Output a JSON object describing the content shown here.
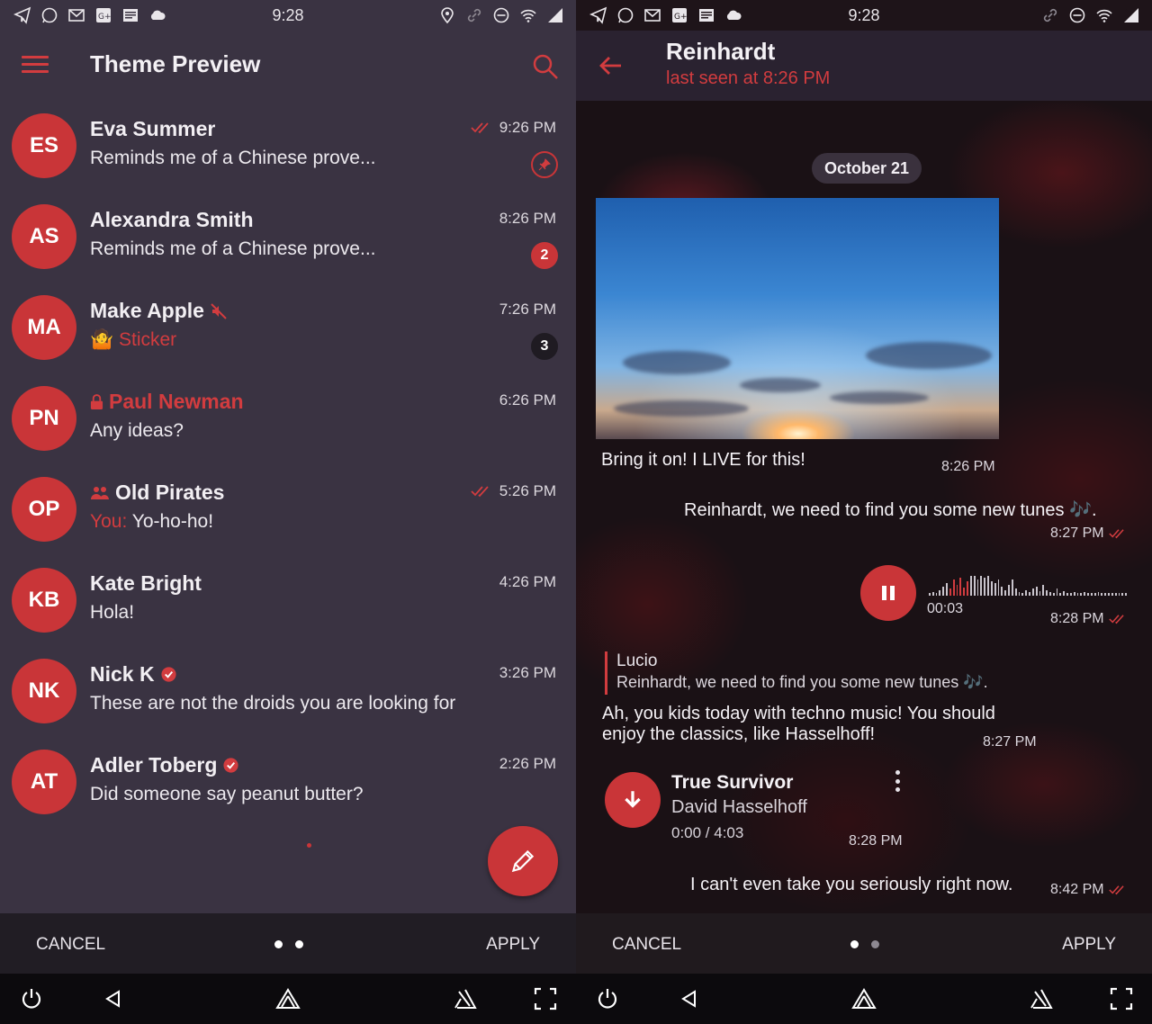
{
  "status_bar": {
    "time": "9:28"
  },
  "left": {
    "appbar": {
      "title": "Theme Preview"
    },
    "chats": [
      {
        "initials": "ES",
        "name": "Eva Summer",
        "message": "Reminds me of a Chinese prove...",
        "time": "9:26 PM",
        "read": true,
        "pinned": true
      },
      {
        "initials": "AS",
        "name": "Alexandra Smith",
        "message": "Reminds me of a Chinese prove...",
        "time": "8:26 PM",
        "badge": "2"
      },
      {
        "initials": "MA",
        "name": "Make Apple",
        "muted": true,
        "sticker_label": "Sticker",
        "time": "7:26 PM",
        "badge": "3"
      },
      {
        "initials": "PN",
        "name": "Paul Newman",
        "secret": true,
        "message": "Any ideas?",
        "time": "6:26 PM"
      },
      {
        "initials": "OP",
        "name": "Old Pirates",
        "group": true,
        "sender_prefix": "You:",
        "message": " Yo-ho-ho!",
        "time": "5:26 PM",
        "read": true
      },
      {
        "initials": "KB",
        "name": "Kate Bright",
        "message": "Hola!",
        "time": "4:26 PM"
      },
      {
        "initials": "NK",
        "name": "Nick K",
        "verified": true,
        "message": "These are not the droids you are looking for",
        "time": "3:26 PM"
      },
      {
        "initials": "AT",
        "name": "Adler Toberg",
        "verified": true,
        "message": "Did someone say peanut butter?",
        "time": "2:26 PM"
      }
    ],
    "bottom": {
      "cancel": "CANCEL",
      "apply": "APPLY"
    }
  },
  "right": {
    "header": {
      "name": "Reinhardt",
      "status": "last seen at 8:26 PM"
    },
    "date_pill": "October 21",
    "messages": {
      "photo_caption": "Bring it on! I LIVE for this!",
      "photo_time": "8:26 PM",
      "out1_text": "Reinhardt, we need to find you some new tunes 🎶.",
      "out1_time": "8:27 PM",
      "voice_duration": "00:03",
      "voice_time": "8:28 PM",
      "reply_name": "Lucio",
      "reply_text": "Reinhardt, we need to find you some new tunes 🎶.",
      "in2_line1": "Ah, you kids today with techno music! You should",
      "in2_line2": "enjoy the classics, like Hasselhoff!",
      "in2_time": "8:27 PM",
      "track_title": "True Survivor",
      "track_artist": "David Hasselhoff",
      "track_progress": "0:00 / 4:03",
      "track_time": "8:28 PM",
      "out3_text": "I can't even take you seriously right now.",
      "out3_time": "8:42 PM"
    },
    "bottom": {
      "cancel": "CANCEL",
      "apply": "APPLY"
    }
  },
  "colors": {
    "accent": "#c93538",
    "list_bg": "#3a3342",
    "bar_bg": "#211d24"
  }
}
